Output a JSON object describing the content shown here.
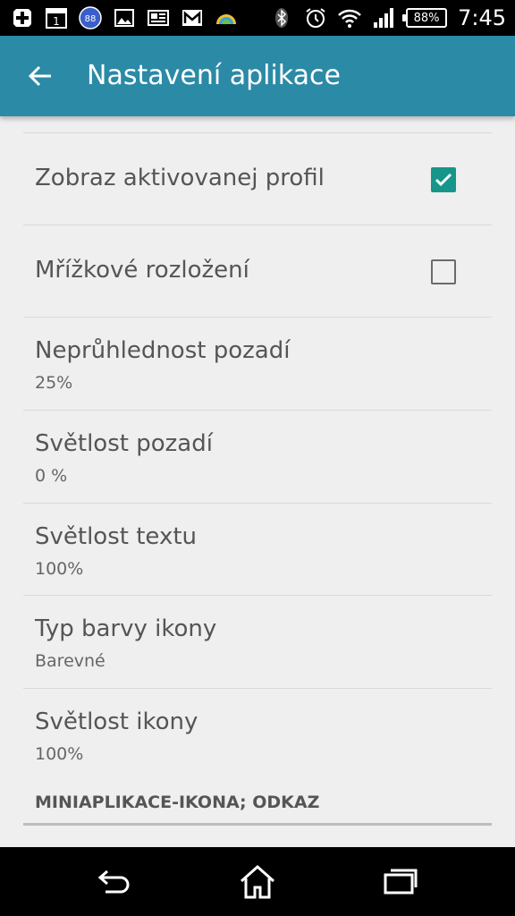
{
  "status_bar": {
    "battery": "88%",
    "time": "7:45",
    "notification_icons": [
      "plus-icon",
      "calendar-icon",
      "badge-88-icon",
      "image-icon",
      "news-icon",
      "mail-icon",
      "rainbow-icon"
    ],
    "calendar_day": "1",
    "badge_number": "88",
    "system_icons": [
      "bluetooth-icon",
      "alarm-icon",
      "wifi-icon",
      "signal-icon"
    ]
  },
  "action_bar": {
    "title": "Nastavení aplikace",
    "color": "#2b8aa6"
  },
  "settings": [
    {
      "title": "Zobraz aktivovanej profil",
      "type": "checkbox",
      "checked": true
    },
    {
      "title": "Mřížkové rozložení",
      "type": "checkbox",
      "checked": false
    },
    {
      "title": "Neprůhlednost pozadí",
      "summary": "25%"
    },
    {
      "title": "Světlost pozadí",
      "summary": "0 %"
    },
    {
      "title": "Světlost textu",
      "summary": "100%"
    },
    {
      "title": "Typ barvy ikony",
      "summary": "Barevné"
    },
    {
      "title": "Světlost ikony",
      "summary": "100%"
    }
  ],
  "section_header": "MINIAPLIKACE-IKONA; ODKAZ",
  "accent_color": "#16968a",
  "nav_bar": [
    "back-icon",
    "home-icon",
    "recents-icon"
  ]
}
